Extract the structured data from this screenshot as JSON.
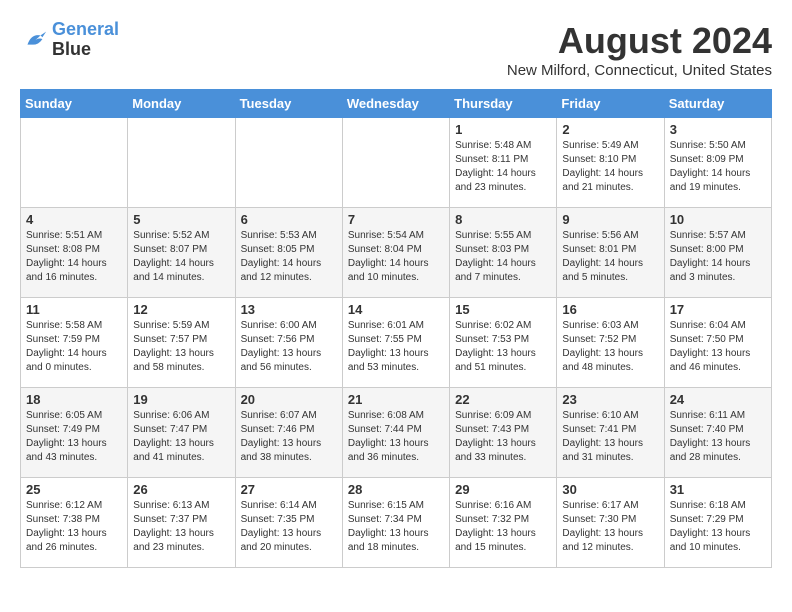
{
  "logo": {
    "line1": "General",
    "line2": "Blue"
  },
  "title": "August 2024",
  "location": "New Milford, Connecticut, United States",
  "weekdays": [
    "Sunday",
    "Monday",
    "Tuesday",
    "Wednesday",
    "Thursday",
    "Friday",
    "Saturday"
  ],
  "weeks": [
    [
      {
        "day": "",
        "info": ""
      },
      {
        "day": "",
        "info": ""
      },
      {
        "day": "",
        "info": ""
      },
      {
        "day": "",
        "info": ""
      },
      {
        "day": "1",
        "info": "Sunrise: 5:48 AM\nSunset: 8:11 PM\nDaylight: 14 hours\nand 23 minutes."
      },
      {
        "day": "2",
        "info": "Sunrise: 5:49 AM\nSunset: 8:10 PM\nDaylight: 14 hours\nand 21 minutes."
      },
      {
        "day": "3",
        "info": "Sunrise: 5:50 AM\nSunset: 8:09 PM\nDaylight: 14 hours\nand 19 minutes."
      }
    ],
    [
      {
        "day": "4",
        "info": "Sunrise: 5:51 AM\nSunset: 8:08 PM\nDaylight: 14 hours\nand 16 minutes."
      },
      {
        "day": "5",
        "info": "Sunrise: 5:52 AM\nSunset: 8:07 PM\nDaylight: 14 hours\nand 14 minutes."
      },
      {
        "day": "6",
        "info": "Sunrise: 5:53 AM\nSunset: 8:05 PM\nDaylight: 14 hours\nand 12 minutes."
      },
      {
        "day": "7",
        "info": "Sunrise: 5:54 AM\nSunset: 8:04 PM\nDaylight: 14 hours\nand 10 minutes."
      },
      {
        "day": "8",
        "info": "Sunrise: 5:55 AM\nSunset: 8:03 PM\nDaylight: 14 hours\nand 7 minutes."
      },
      {
        "day": "9",
        "info": "Sunrise: 5:56 AM\nSunset: 8:01 PM\nDaylight: 14 hours\nand 5 minutes."
      },
      {
        "day": "10",
        "info": "Sunrise: 5:57 AM\nSunset: 8:00 PM\nDaylight: 14 hours\nand 3 minutes."
      }
    ],
    [
      {
        "day": "11",
        "info": "Sunrise: 5:58 AM\nSunset: 7:59 PM\nDaylight: 14 hours\nand 0 minutes."
      },
      {
        "day": "12",
        "info": "Sunrise: 5:59 AM\nSunset: 7:57 PM\nDaylight: 13 hours\nand 58 minutes."
      },
      {
        "day": "13",
        "info": "Sunrise: 6:00 AM\nSunset: 7:56 PM\nDaylight: 13 hours\nand 56 minutes."
      },
      {
        "day": "14",
        "info": "Sunrise: 6:01 AM\nSunset: 7:55 PM\nDaylight: 13 hours\nand 53 minutes."
      },
      {
        "day": "15",
        "info": "Sunrise: 6:02 AM\nSunset: 7:53 PM\nDaylight: 13 hours\nand 51 minutes."
      },
      {
        "day": "16",
        "info": "Sunrise: 6:03 AM\nSunset: 7:52 PM\nDaylight: 13 hours\nand 48 minutes."
      },
      {
        "day": "17",
        "info": "Sunrise: 6:04 AM\nSunset: 7:50 PM\nDaylight: 13 hours\nand 46 minutes."
      }
    ],
    [
      {
        "day": "18",
        "info": "Sunrise: 6:05 AM\nSunset: 7:49 PM\nDaylight: 13 hours\nand 43 minutes."
      },
      {
        "day": "19",
        "info": "Sunrise: 6:06 AM\nSunset: 7:47 PM\nDaylight: 13 hours\nand 41 minutes."
      },
      {
        "day": "20",
        "info": "Sunrise: 6:07 AM\nSunset: 7:46 PM\nDaylight: 13 hours\nand 38 minutes."
      },
      {
        "day": "21",
        "info": "Sunrise: 6:08 AM\nSunset: 7:44 PM\nDaylight: 13 hours\nand 36 minutes."
      },
      {
        "day": "22",
        "info": "Sunrise: 6:09 AM\nSunset: 7:43 PM\nDaylight: 13 hours\nand 33 minutes."
      },
      {
        "day": "23",
        "info": "Sunrise: 6:10 AM\nSunset: 7:41 PM\nDaylight: 13 hours\nand 31 minutes."
      },
      {
        "day": "24",
        "info": "Sunrise: 6:11 AM\nSunset: 7:40 PM\nDaylight: 13 hours\nand 28 minutes."
      }
    ],
    [
      {
        "day": "25",
        "info": "Sunrise: 6:12 AM\nSunset: 7:38 PM\nDaylight: 13 hours\nand 26 minutes."
      },
      {
        "day": "26",
        "info": "Sunrise: 6:13 AM\nSunset: 7:37 PM\nDaylight: 13 hours\nand 23 minutes."
      },
      {
        "day": "27",
        "info": "Sunrise: 6:14 AM\nSunset: 7:35 PM\nDaylight: 13 hours\nand 20 minutes."
      },
      {
        "day": "28",
        "info": "Sunrise: 6:15 AM\nSunset: 7:34 PM\nDaylight: 13 hours\nand 18 minutes."
      },
      {
        "day": "29",
        "info": "Sunrise: 6:16 AM\nSunset: 7:32 PM\nDaylight: 13 hours\nand 15 minutes."
      },
      {
        "day": "30",
        "info": "Sunrise: 6:17 AM\nSunset: 7:30 PM\nDaylight: 13 hours\nand 12 minutes."
      },
      {
        "day": "31",
        "info": "Sunrise: 6:18 AM\nSunset: 7:29 PM\nDaylight: 13 hours\nand 10 minutes."
      }
    ]
  ]
}
